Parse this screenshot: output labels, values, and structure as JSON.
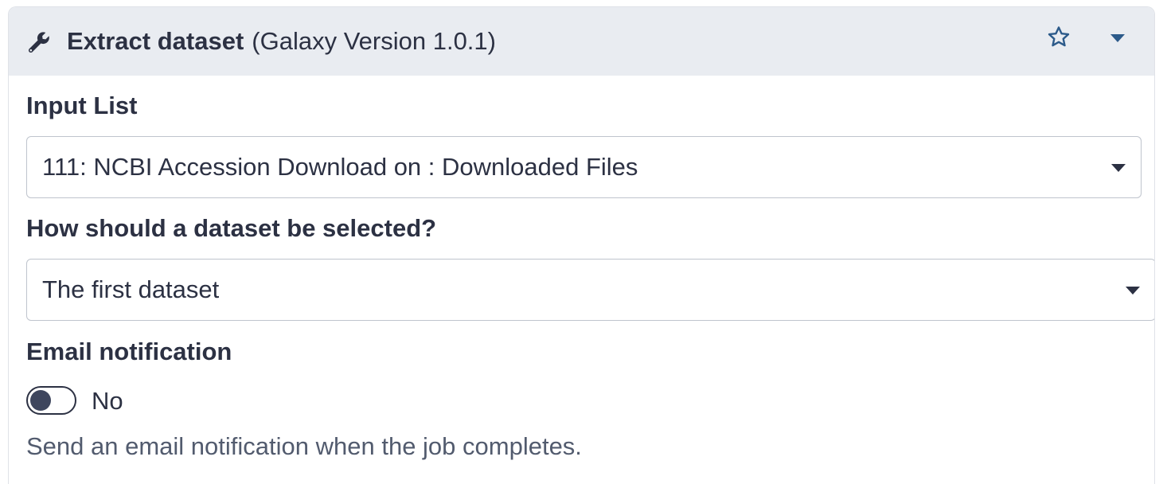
{
  "tool": {
    "name": "Extract dataset",
    "version": "(Galaxy Version 1.0.1)",
    "icons": {
      "tool": "wrench-icon",
      "favorite": "star-icon",
      "menu": "caret-down-icon"
    }
  },
  "form": {
    "input_list": {
      "label": "Input List",
      "value": "111: NCBI Accession Download on : Downloaded Files"
    },
    "selection": {
      "label": "How should a dataset be selected?",
      "value": "The first dataset"
    },
    "email": {
      "label": "Email notification",
      "toggle_state": "No",
      "help": "Send an email notification when the job completes."
    }
  },
  "colors": {
    "header_bg": "#e9ecf1",
    "icon_blue": "#2c5a8a",
    "text": "#2c3143"
  }
}
